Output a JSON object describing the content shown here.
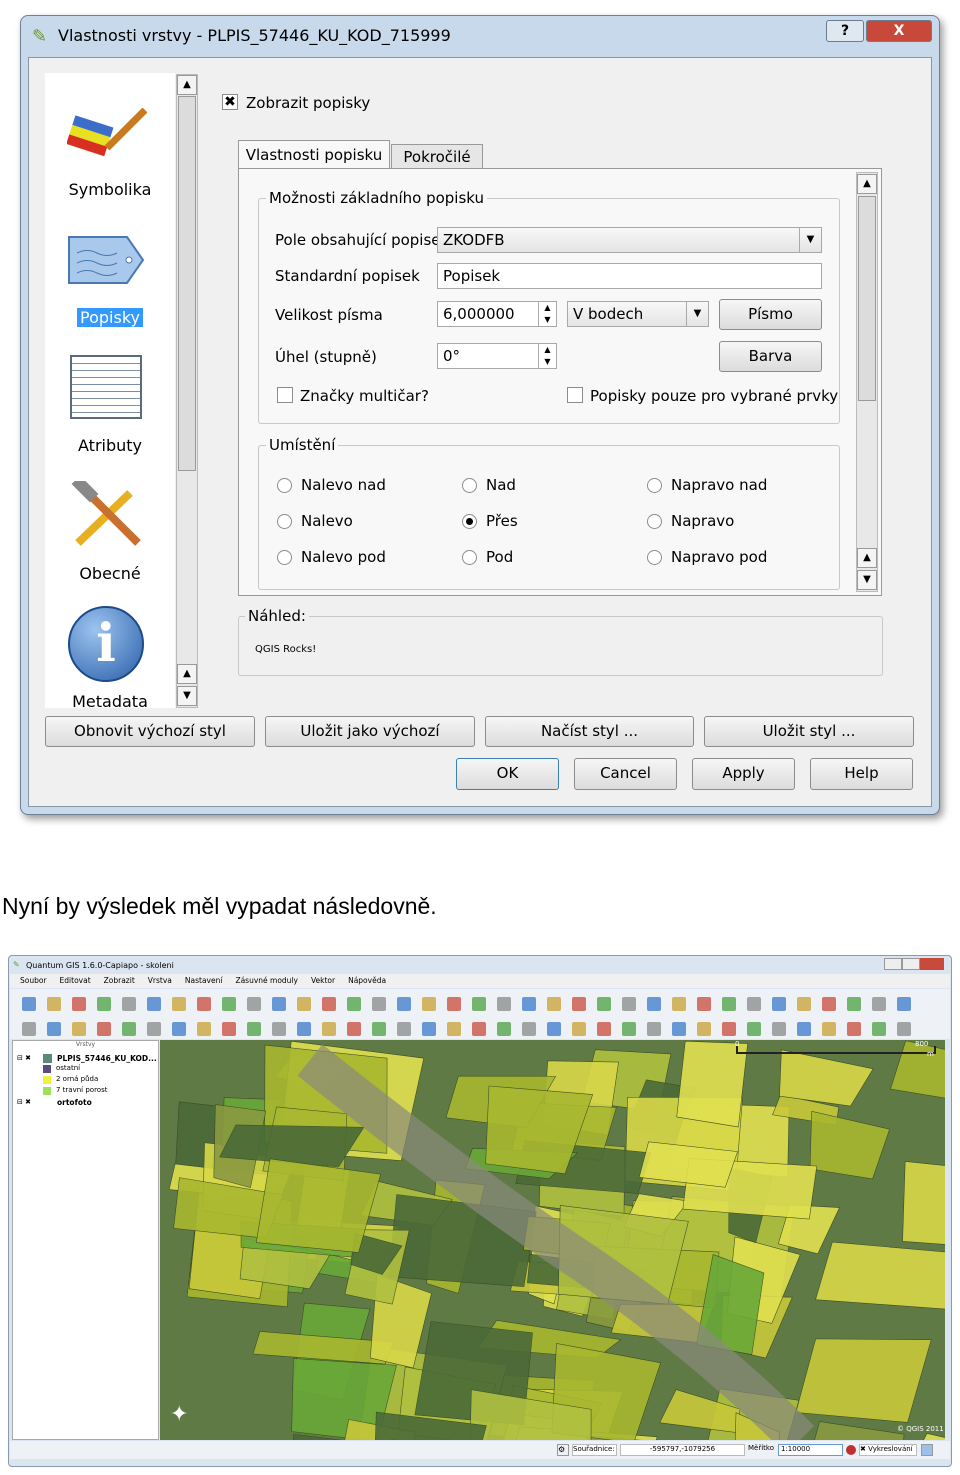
{
  "dialog": {
    "title": "Vlastnosti vrstvy - PLPIS_57446_KU_KOD_715999",
    "help_btn": "?",
    "close_btn": "X",
    "sidebar": [
      {
        "label": "Symbolika",
        "icon": "brush-icon"
      },
      {
        "label": "Popisky",
        "icon": "label-tag-icon",
        "selected": true
      },
      {
        "label": "Atributy",
        "icon": "table-icon"
      },
      {
        "label": "Obecné",
        "icon": "tools-icon"
      },
      {
        "label": "Metadata",
        "icon": "info-icon"
      }
    ],
    "show_labels": {
      "label": "Zobrazit popisky",
      "checked": true
    },
    "tabs": [
      "Vlastnosti popisku",
      "Pokročilé"
    ],
    "basic_group": {
      "title": "Možnosti základního popisku",
      "field_label": "Pole obsahující popisek",
      "field_value": "ZKODFB",
      "default_label": "Standardní popisek",
      "default_value": "Popisek",
      "size_label": "Velikost písma",
      "size_value": "6,000000",
      "units_value": "V bodech",
      "font_btn": "Písmo",
      "angle_label": "Úhel (stupně)",
      "angle_value": "0°",
      "color_btn": "Barva",
      "multiline_label": "Značky multičar?",
      "selected_only_label": "Popisky pouze pro vybrané prvky"
    },
    "placement_group": {
      "title": "Umístění",
      "options": [
        "Nalevo nad",
        "Nad",
        "Napravo nad",
        "Nalevo",
        "Přes",
        "Napravo",
        "Nalevo pod",
        "Pod",
        "Napravo pod"
      ],
      "selected": "Přes"
    },
    "preview": {
      "title": "Náhled:",
      "text": "QGIS Rocks!"
    },
    "style_buttons": [
      "Obnovit výchozí styl",
      "Uložit jako výchozí",
      "Načíst styl ...",
      "Uložit styl ..."
    ],
    "buttons": [
      "OK",
      "Cancel",
      "Apply",
      "Help"
    ]
  },
  "caption": "Nyní by výsledek měl vypadat následovně.",
  "qgis": {
    "title": "Quantum GIS 1.6.0-Capiapo - skoleni",
    "menu": [
      "Soubor",
      "Editovat",
      "Zobrazit",
      "Vrstva",
      "Nastavení",
      "Zásuvné moduly",
      "Vektor",
      "Nápověda"
    ],
    "layers_title": "Vrstvy",
    "layers": [
      {
        "name": "PLPIS_57446_KU_KOD...",
        "children": [
          {
            "name": "ostatní",
            "color": "#5b4a8a"
          },
          {
            "name": "2 orná půda",
            "color": "#f0f040"
          },
          {
            "name": "7 travní porost",
            "color": "#9ee05a"
          }
        ]
      },
      {
        "name": "ortofoto"
      }
    ],
    "scale_bar": {
      "start": "0",
      "end": "800",
      "unit": "m"
    },
    "copyright": "© QGIS 2011",
    "status": {
      "coords_label": "Souřadnice:",
      "coords_value": "-595797,-1079256",
      "scale_label": "Měřítko",
      "scale_value": "1:10000",
      "render_label": "Vykreslování"
    }
  }
}
